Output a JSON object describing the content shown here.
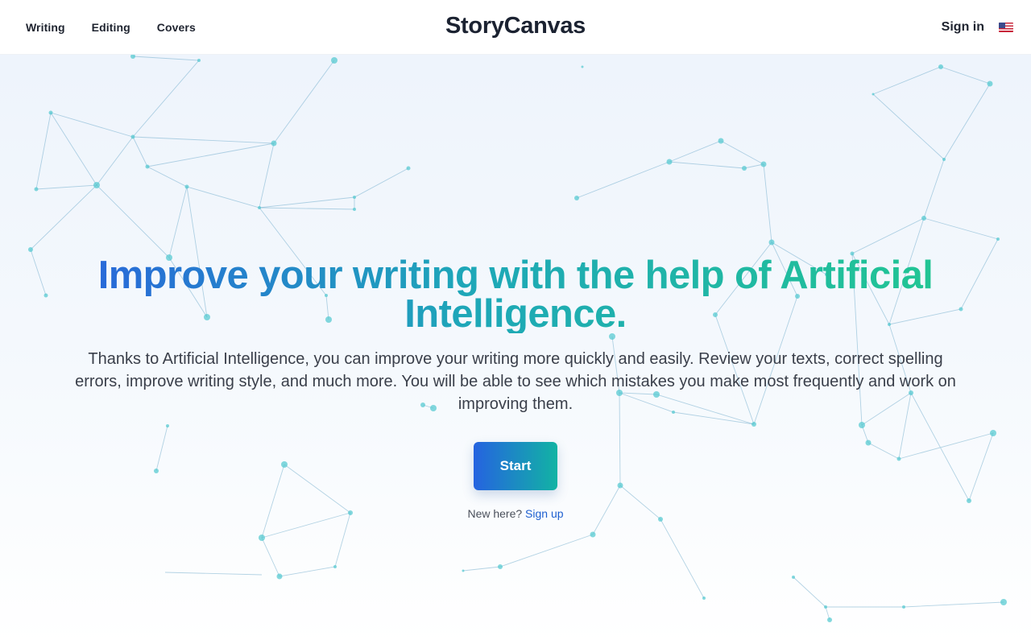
{
  "header": {
    "nav": [
      {
        "label": "Writing"
      },
      {
        "label": "Editing"
      },
      {
        "label": "Covers"
      }
    ],
    "brand": "StoryCanvas",
    "sign_in": "Sign in",
    "language_flag": "us-flag-icon"
  },
  "hero": {
    "headline_line1": "Improve your writing with the help of Artificial",
    "headline_line2": "Intelligence.",
    "subtext_line1": "Thanks to Artificial Intelligence, you can improve your writing more quickly and easily. Review your texts, correct spelling",
    "subtext_line2": "errors, improve writing style, and much more. You will be able to see which mistakes you make most frequently and work on",
    "subtext_line3": "improving them.",
    "cta_label": "Start",
    "signup_prompt": "New here?",
    "signup_link": "Sign up"
  },
  "theme": {
    "gradient_start": "#2a5fde",
    "gradient_end": "#22c98f",
    "link_color": "#1d5fd0",
    "network_color": "#5aa9c7"
  }
}
